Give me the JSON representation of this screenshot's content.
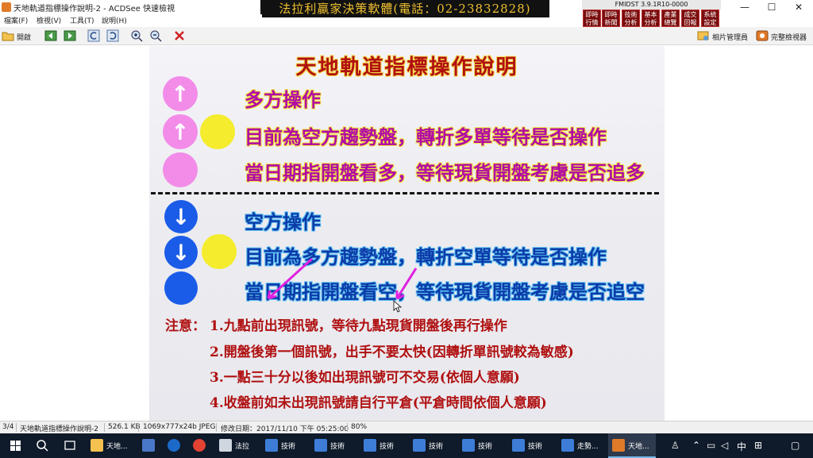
{
  "window": {
    "title": "天地軌道指標操作說明-2 - ACDSee 快速檢視",
    "controls": [
      "—",
      "☐",
      "✕"
    ]
  },
  "banner": {
    "text": "法拉利贏家決策軟體(電話：02-23832828)"
  },
  "fmidst": {
    "version": "FMIDST 3.9.1R10-0000",
    "buttons": [
      {
        "top": "即時",
        "bottom": "行情"
      },
      {
        "top": "即時",
        "bottom": "新聞"
      },
      {
        "top": "技術",
        "bottom": "分析"
      },
      {
        "top": "基本",
        "bottom": "分析"
      },
      {
        "top": "產業",
        "bottom": "總覽"
      },
      {
        "top": "成交",
        "bottom": "回報"
      },
      {
        "top": "系統",
        "bottom": "設定"
      }
    ]
  },
  "menu": {
    "items": [
      "檔案(F)",
      "檢視(V)",
      "工具(T)",
      "說明(H)"
    ]
  },
  "toolbar": {
    "open_label": "開啟",
    "photo_manager_label": "相片管理員",
    "full_viewer_label": "完整檢視器"
  },
  "slide": {
    "title": "天地軌道指標操作說明",
    "bull": {
      "heading": "多方操作",
      "line1": "目前為空方趨勢盤，轉折多單等待是否操作",
      "line2": "當日期指開盤看多，等待現貨開盤考慮是否追多"
    },
    "bear": {
      "heading": "空方操作",
      "line1": "目前為多方趨勢盤，轉折空單等待是否操作",
      "line2": "當日期指開盤看空，等待現貨開盤考慮是否追空"
    },
    "notes_label": "注意：",
    "notes": [
      "1.九點前出現訊號，等待九點現貨開盤後再行操作",
      "2.開盤後第一個訊號，出手不要太快(因轉折單訊號較為敏感)",
      "3.一點三十分以後如出現訊號可不交易(依個人意願)",
      "4.收盤前如未出現訊號請自行平倉(平倉時間依個人意願)"
    ]
  },
  "status": {
    "index": "3/4",
    "filename": "天地軌道指標操作說明-2",
    "size": "526.1 KB",
    "info": "1069x777x24b JPEG",
    "modified": "修改日期：2017/11/10 下午 05:25:00",
    "zoom": "80%"
  },
  "taskbar": {
    "items": [
      "天地...",
      "法拉",
      "技術",
      "技術",
      "技術",
      "技術",
      "技術",
      "走勢...",
      "天地..."
    ],
    "tray_ime": "中",
    "colors": {
      "bg": "#0f1a2a",
      "accent": "#76b9ed"
    }
  }
}
